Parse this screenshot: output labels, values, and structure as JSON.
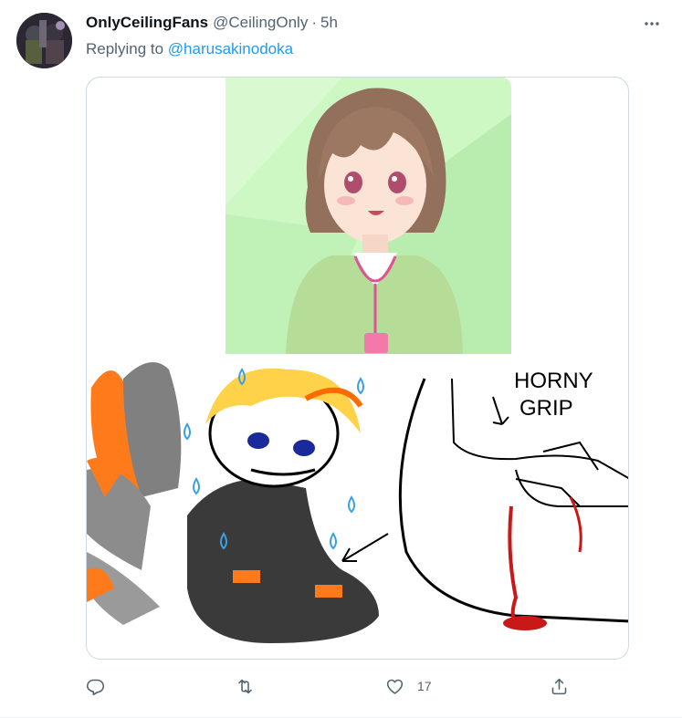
{
  "tweet": {
    "display_name": "OnlyCeilingFans",
    "handle": "@CeilingOnly",
    "separator": "·",
    "time": "5h",
    "replying_prefix": "Replying to",
    "replying_to": "@harusakinodoka",
    "media": {
      "top_image": "anime-girl-illustration",
      "bottom_image": "meme-drawing",
      "caption_text_line1": "HORNY",
      "caption_text_line2": "GRIP"
    },
    "actions": {
      "reply_icon": "reply-icon",
      "retweet_icon": "retweet-icon",
      "like_icon": "like-icon",
      "like_count": "17",
      "share_icon": "share-icon"
    },
    "colors": {
      "accent": "#1d9bf0",
      "secondary_text": "#536471",
      "border": "#cfd9de"
    }
  }
}
